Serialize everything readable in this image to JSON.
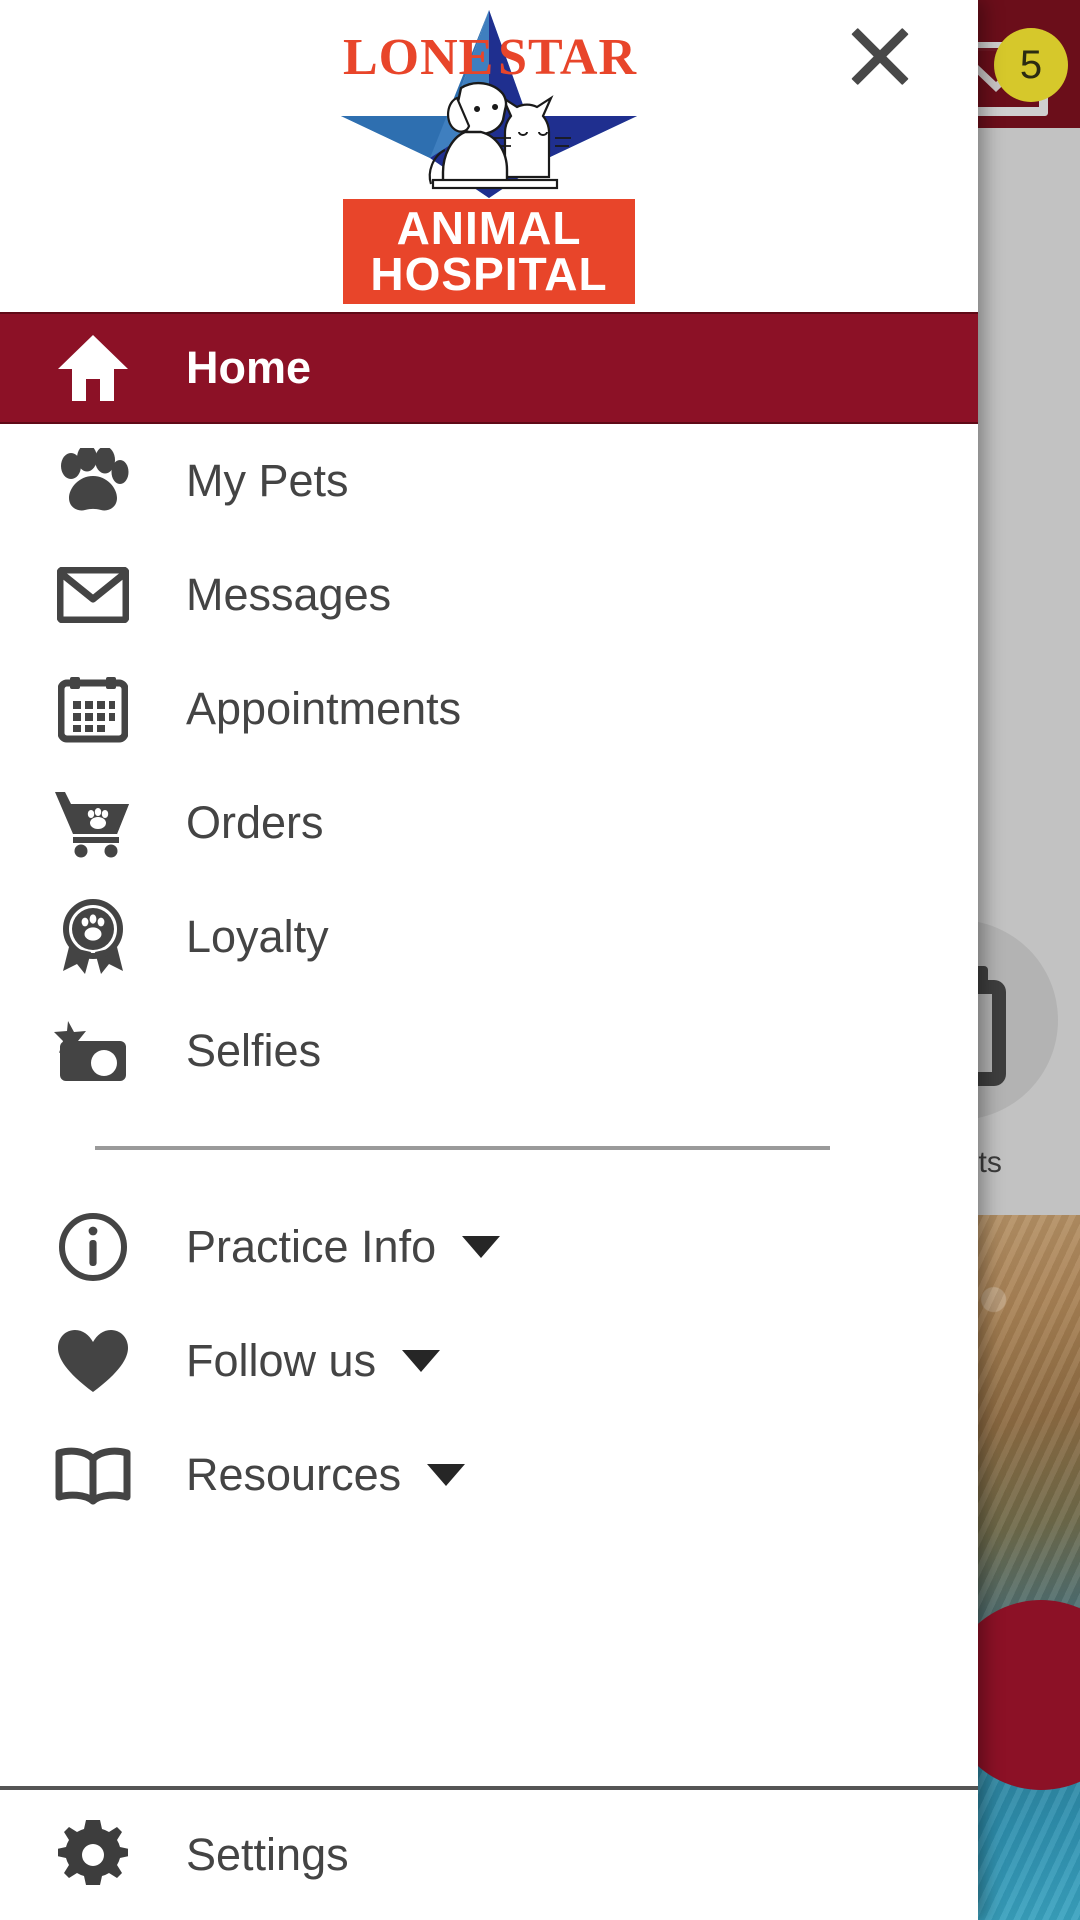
{
  "background": {
    "appbar": {
      "color": "#6b0e1a"
    },
    "mail": {
      "icon": "mail-icon",
      "badge_count": "5",
      "badge_color": "#d6c82b"
    },
    "quick_action": {
      "icon": "appointments-icon",
      "label": "ments"
    },
    "fab": {
      "color": "#8c1126"
    },
    "scrim_color": "#c2c2c2"
  },
  "drawer": {
    "close": {
      "icon": "close-icon",
      "label": "Close"
    },
    "logo": {
      "word_left": "LONE",
      "word_right": "STAR",
      "block_line1": "ANIMAL",
      "block_line2": "HOSPITAL",
      "accent_color": "#e8452a",
      "star_color": "#1f2f8f"
    },
    "primary_items": [
      {
        "label": "Home",
        "icon": "home-icon",
        "active": true
      },
      {
        "label": "My Pets",
        "icon": "paw-icon",
        "active": false
      },
      {
        "label": "Messages",
        "icon": "mail-icon",
        "active": false
      },
      {
        "label": "Appointments",
        "icon": "calendar-icon",
        "active": false
      },
      {
        "label": "Orders",
        "icon": "shopping-cart-paw-icon",
        "active": false
      },
      {
        "label": "Loyalty",
        "icon": "award-paw-icon",
        "active": false
      },
      {
        "label": "Selfies",
        "icon": "camera-star-icon",
        "active": false
      }
    ],
    "secondary_items": [
      {
        "label": "Practice Info",
        "icon": "info-circle-icon",
        "expandable": true
      },
      {
        "label": "Follow us",
        "icon": "heart-icon",
        "expandable": true
      },
      {
        "label": "Resources",
        "icon": "book-icon",
        "expandable": true
      }
    ],
    "footer_items": [
      {
        "label": "Settings",
        "icon": "gear-icon"
      }
    ],
    "active_color": "#8c1126",
    "text_color": "#444444"
  }
}
